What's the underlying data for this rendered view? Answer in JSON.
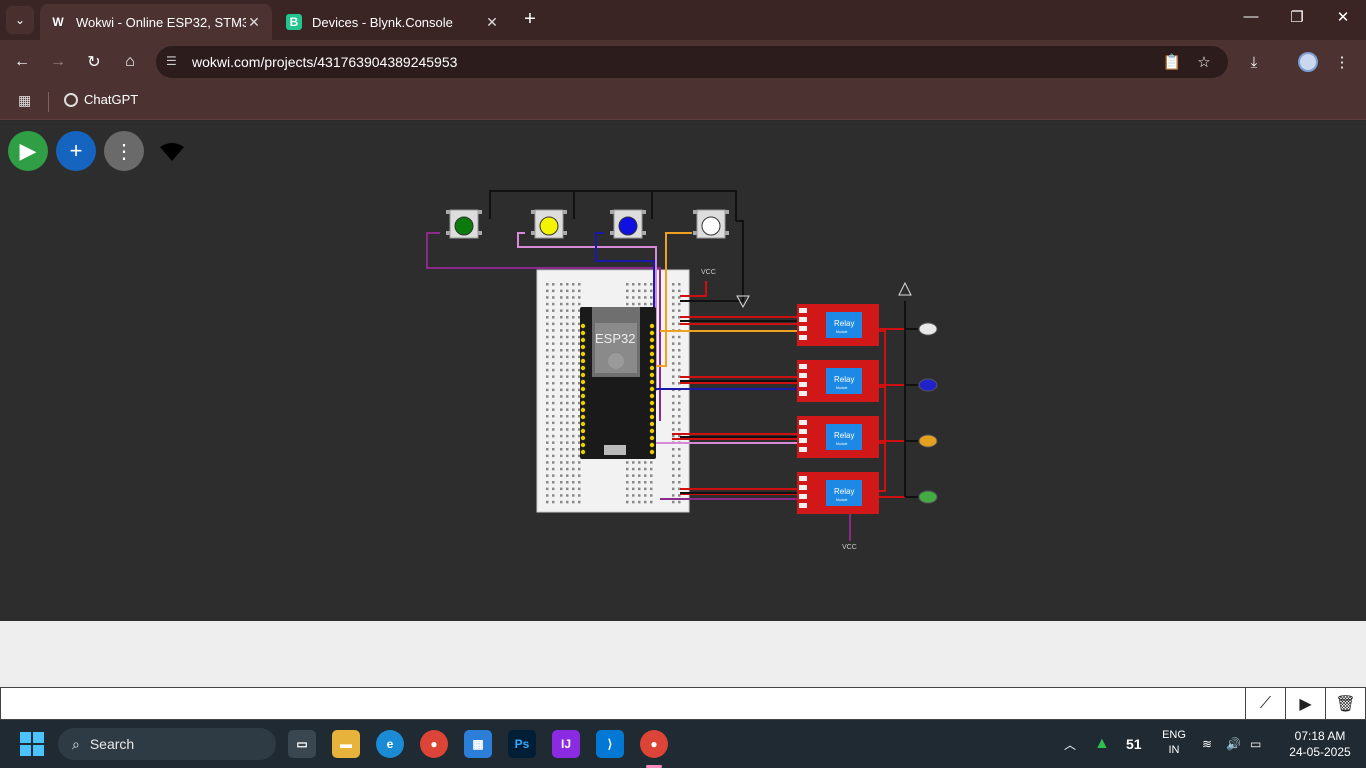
{
  "browser": {
    "tabs": [
      {
        "title": "Wokwi - Online ESP32, STM32, Arduino",
        "favicon": "W",
        "active": true
      },
      {
        "title": "Devices - Blynk.Console",
        "favicon": "B",
        "active": false
      }
    ],
    "url": "wokwi.com/projects/431763904389245953",
    "bookmarks": [
      {
        "label": "ChatGPT"
      }
    ]
  },
  "canvas": {
    "buttons": {
      "run": "▶",
      "add": "+",
      "more": "⋮"
    },
    "labels": {
      "esp32": "ESP32",
      "vcc_top": "VCC",
      "vcc_bottom": "VCC",
      "relay_title": "Relay",
      "relay_sub": "Module"
    },
    "pushbutton_colors": [
      "#0a7a0a",
      "#f4f400",
      "#1010e0",
      "#ffffff"
    ],
    "led_colors": [
      "#e8e8e8",
      "#2222cc",
      "#e6a020",
      "#44aa44"
    ],
    "wire_colors": {
      "black": "#111111",
      "purple": "#8a2a8a",
      "pink": "#d88ad8",
      "blue": "#1a1aaa",
      "orange": "#f0a020",
      "red": "#d01010"
    }
  },
  "serial": {
    "input_value": "",
    "icons": [
      "chart-icon",
      "play-icon",
      "trash-icon"
    ]
  },
  "taskbar": {
    "search": "Search",
    "apps": [
      "task-view",
      "file-explorer",
      "edge",
      "chrome",
      "store",
      "photoshop",
      "intellij",
      "vscode",
      "chrome-profile"
    ],
    "tray": {
      "aqi": "51",
      "lang1": "ENG",
      "lang2": "IN",
      "time": "07:18 AM",
      "date": "24-05-2025"
    }
  }
}
